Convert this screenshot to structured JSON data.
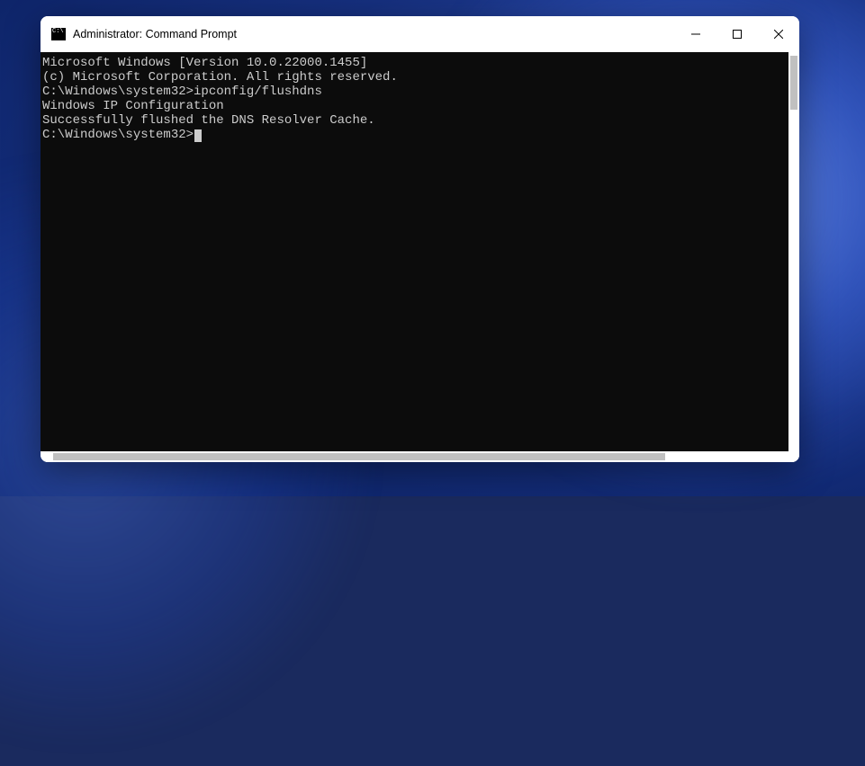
{
  "window": {
    "title": "Administrator: Command Prompt"
  },
  "terminal": {
    "lines": [
      "Microsoft Windows [Version 10.0.22000.1455]",
      "(c) Microsoft Corporation. All rights reserved.",
      "",
      "C:\\Windows\\system32>ipconfig/flushdns",
      "",
      "Windows IP Configuration",
      "",
      "Successfully flushed the DNS Resolver Cache.",
      "",
      "C:\\Windows\\system32>"
    ],
    "prompt_index": 9
  }
}
